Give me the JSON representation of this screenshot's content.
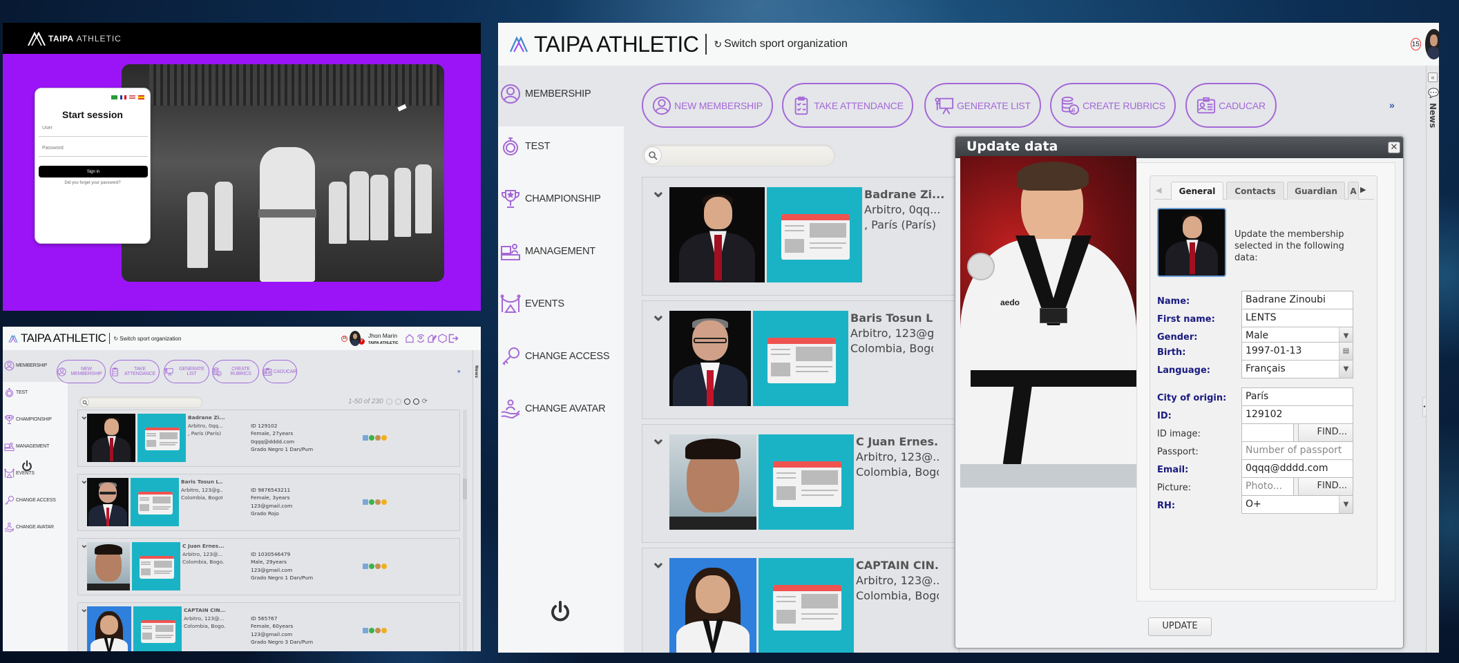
{
  "login": {
    "brand_bold": "TAIPA",
    "brand_light": "ATHLETIC",
    "languages": [
      "pt-BR",
      "fr",
      "en-US",
      "es"
    ],
    "title": "Start session",
    "user_placeholder": "User",
    "password_placeholder": "Password",
    "signin_label": "Sign in",
    "forgot_label": "Did you forget your password?"
  },
  "app": {
    "title": "TAIPA ATHLETIC",
    "switch_label": "Switch sport organization",
    "notifications": "15",
    "user_name": "Jhon Marin",
    "user_org": "TAIPA ATHLETIC",
    "header_icons": [
      "home-star-icon",
      "refresh-user-icon",
      "edit-star-icon",
      "hexagon-icon",
      "logout-icon"
    ],
    "news_label": "News",
    "colors": {
      "accent": "#a468d6",
      "id_card_bg": "#1ab3c6",
      "login_bg": "#9b14f7"
    }
  },
  "sidebar": {
    "items": [
      {
        "label": "MEMBERSHIP",
        "icon": "user-circle-icon",
        "selected": true
      },
      {
        "label": "TEST",
        "icon": "stopwatch-icon"
      },
      {
        "label": "CHAMPIONSHIP",
        "icon": "trophy-icon"
      },
      {
        "label": "MANAGEMENT",
        "icon": "management-icon"
      },
      {
        "label": "EVENTS",
        "icon": "events-icon"
      },
      {
        "label": "CHANGE ACCESS",
        "icon": "key-icon"
      },
      {
        "label": "CHANGE AVATAR",
        "icon": "avatar-hand-icon"
      }
    ],
    "power_icon": "power-icon"
  },
  "toolbar": {
    "buttons": [
      {
        "label": "NEW MEMBERSHIP",
        "icon": "user-circle-icon"
      },
      {
        "label": "TAKE ATTENDANCE",
        "icon": "clipboard-check-icon"
      },
      {
        "label": "GENERATE LIST",
        "icon": "presentation-icon"
      },
      {
        "label": "CREATE RUBRICS",
        "icon": "coins-icon"
      },
      {
        "label": "CADUCAR",
        "icon": "id-badge-icon"
      }
    ],
    "more": "»"
  },
  "search": {
    "placeholder": ""
  },
  "pager": {
    "text": "1-50 of 230"
  },
  "members": [
    {
      "name": "Badrane Zi...",
      "line2": "Arbitro, 0qq...",
      "line3": ", París (París)",
      "id": "ID 129102",
      "gender_age": "Female, 27years",
      "email": "0qqq@dddd.com",
      "grade": "Grado Negro 1 Dan/Pum",
      "photo": "suit"
    },
    {
      "name": "Baris Tosun L...",
      "line2": "Arbitro, 123@g...",
      "line3": "Colombia, Bogot...",
      "id": "ID 9876543211",
      "gender_age": "Female, 3years",
      "email": "123@gmail.com",
      "grade": "Grado Rojo",
      "photo": "glasses"
    },
    {
      "name": "C Juan Ernes...",
      "line2": "Arbitro, 123@...",
      "line3": "Colombia, Bogo...",
      "id": "ID 1030546479",
      "gender_age": "Male, 29years",
      "email": "123@gmail.com",
      "grade": "Grado Negro 1 Dan/Pum",
      "photo": "gym"
    },
    {
      "name": "CAPTAIN CIN...",
      "line2": "Arbitro, 123@...",
      "line3": "Colombia, Bogo...",
      "id": "ID 565767",
      "gender_age": "Female, 60years",
      "email": "123@gmail.com",
      "grade": "Grado Negro 3 Dan/Pum",
      "photo": "girl"
    }
  ],
  "dialog": {
    "title": "Update data",
    "tabs": [
      "General",
      "Contacts",
      "Guardian",
      "A"
    ],
    "active_tab": "General",
    "intro": "Update the membership selected in the following data:",
    "fields": {
      "name": {
        "label": "Name:",
        "value": "Badrane Zinoubi"
      },
      "first_name": {
        "label": "First name:",
        "value": "LENTS"
      },
      "gender": {
        "label": "Gender:",
        "value": "Male"
      },
      "birth": {
        "label": "Birth:",
        "value": "1997-01-13"
      },
      "language": {
        "label": "Language:",
        "value": "Français"
      },
      "city": {
        "label": "City of origin:",
        "value": "París"
      },
      "id": {
        "label": "ID:",
        "value": "129102"
      },
      "id_image": {
        "label": "ID image:",
        "value": "",
        "find": "FIND..."
      },
      "passport": {
        "label": "Passport:",
        "placeholder": "Number of passport"
      },
      "email": {
        "label": "Email:",
        "value": "0qqq@dddd.com"
      },
      "picture": {
        "label": "Picture:",
        "placeholder": "Photo...",
        "find": "FIND..."
      },
      "rh": {
        "label": "RH:",
        "value": "O+"
      }
    },
    "update_label": "UPDATE"
  }
}
